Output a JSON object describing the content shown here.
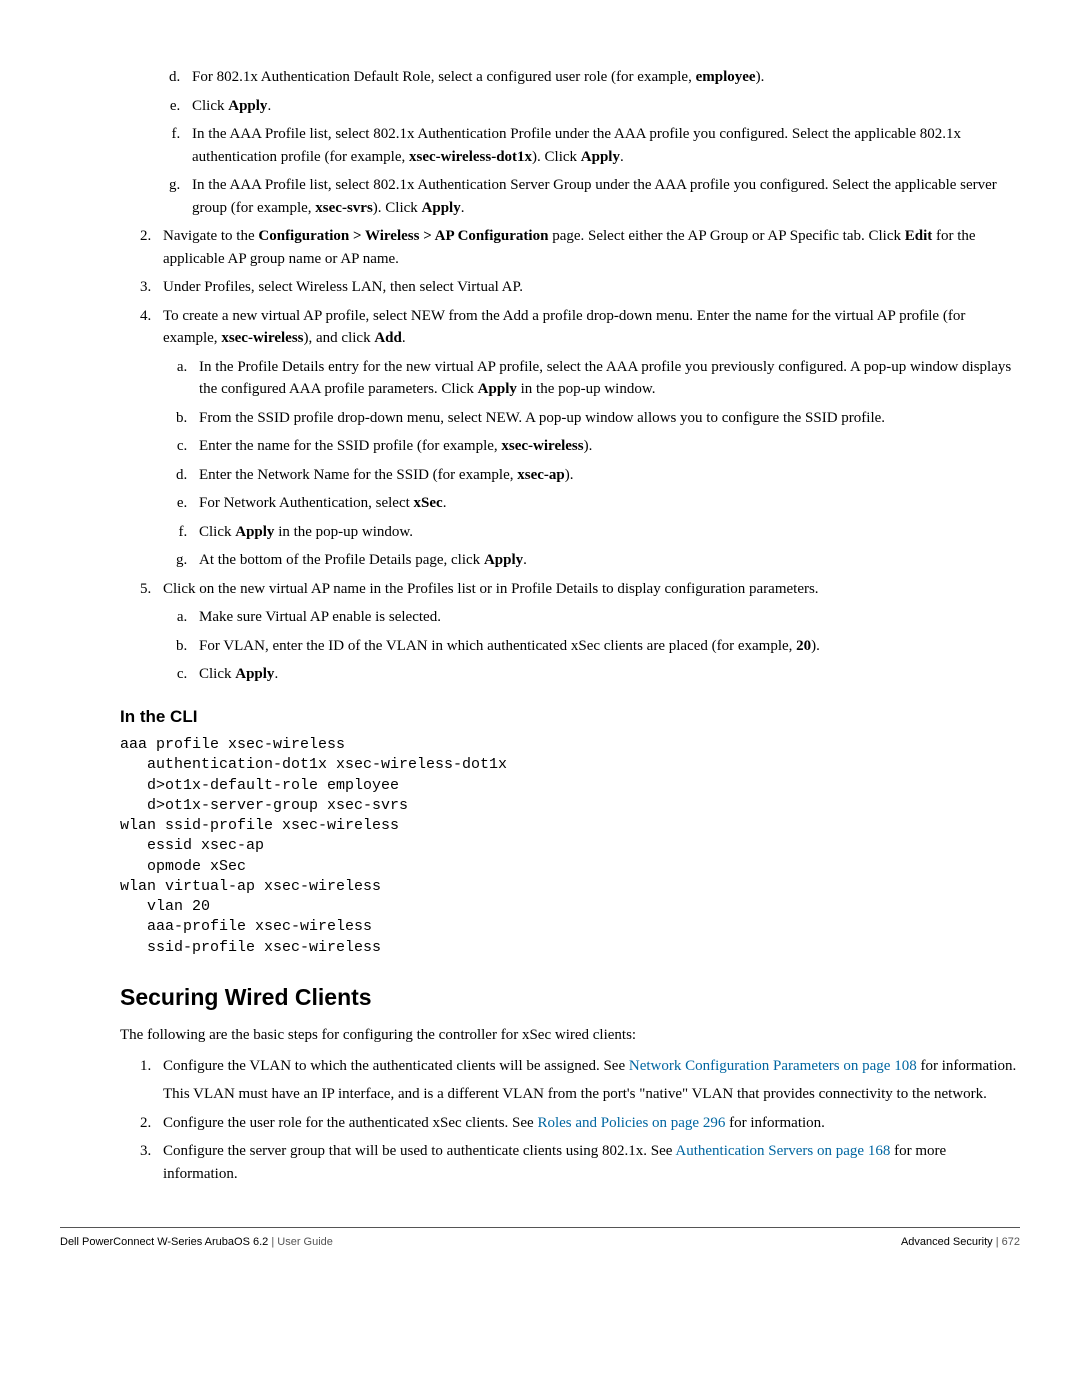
{
  "items_d": {
    "pre": "For 802.1x Authentication Default Role, select a configured user role (for example, ",
    "bold": "employee",
    "post": ")."
  },
  "items_e": {
    "pre": "Click ",
    "bold": "Apply",
    "post": "."
  },
  "items_f": {
    "pre": "In the AAA Profile list, select 802.1x Authentication Profile under the AAA profile you configured. Select the applicable 802.1x authentication profile (for example, ",
    "b1": "xsec-wireless-dot1x",
    "mid": "). Click ",
    "b2": "Apply",
    "post": "."
  },
  "items_g": {
    "pre": "In the AAA Profile list, select 802.1x Authentication Server Group under the AAA profile you configured. Select the applicable server group (for example, ",
    "b1": "xsec-svrs",
    "mid": "). Click ",
    "b2": "Apply",
    "post": "."
  },
  "step2": {
    "pre": "Navigate to the ",
    "b1": "Configuration > Wireless > AP Configuration",
    "mid": " page. Select either the AP Group or AP Specific tab. Click ",
    "b2": "Edit",
    "post": " for the applicable AP group name or AP name."
  },
  "step3": "Under Profiles, select Wireless LAN, then select Virtual AP.",
  "step4": {
    "pre": "To create a new virtual AP profile, select NEW from the Add a profile drop-down menu. Enter the name for the virtual AP profile (for example, ",
    "b1": "xsec-wireless",
    "mid": "), and click ",
    "b2": "Add",
    "post": "."
  },
  "step4a": {
    "pre": "In the Profile Details entry for the new virtual AP profile, select the AAA profile you previously configured. A pop-up window displays the configured AAA profile parameters. Click ",
    "b1": "Apply",
    "post": " in the pop-up window."
  },
  "step4b": "From the SSID profile drop-down menu, select NEW. A pop-up window allows you to configure the SSID profile.",
  "step4c": {
    "pre": "Enter the name for the SSID profile (for example, ",
    "b1": "xsec-wireless",
    "post": ")."
  },
  "step4d": {
    "pre": "Enter the Network Name for the SSID (for example, ",
    "b1": "xsec-ap",
    "post": ")."
  },
  "step4e": {
    "pre": "For Network Authentication, select ",
    "b1": "xSec",
    "post": "."
  },
  "step4f": {
    "pre": "Click ",
    "b1": "Apply",
    "post": " in the pop-up window."
  },
  "step4g": {
    "pre": "At the bottom of the Profile Details page, click ",
    "b1": "Apply",
    "post": "."
  },
  "step5": "Click on the new virtual AP name in the Profiles list or in Profile Details to display configuration parameters.",
  "step5a": "Make sure Virtual AP enable is selected.",
  "step5b": {
    "pre": "For VLAN, enter the ID of the VLAN in which authenticated xSec clients are placed (for example, ",
    "b1": "20",
    "post": ")."
  },
  "step5c": {
    "pre": "Click ",
    "b1": "Apply",
    "post": "."
  },
  "cli_heading": "In the CLI",
  "cli_code": "aaa profile xsec-wireless\n   authentication-dot1x xsec-wireless-dot1x\n   d>ot1x-default-role employee\n   d>ot1x-server-group xsec-svrs\nwlan ssid-profile xsec-wireless\n   essid xsec-ap\n   opmode xSec\nwlan virtual-ap xsec-wireless\n   vlan 20\n   aaa-profile xsec-wireless\n   ssid-profile xsec-wireless",
  "section_heading": "Securing Wired Clients",
  "para_intro": "The following are the basic steps for configuring the controller for xSec wired clients:",
  "wired1": {
    "pre": "Configure the VLAN to which the authenticated clients will be assigned. See ",
    "link": "Network Configuration Parameters on page 108",
    "post": " for information."
  },
  "wired1_note": "This VLAN must have an IP interface, and is a different VLAN from the port's \"native\" VLAN that provides connectivity to the network.",
  "wired2": {
    "pre": "Configure the user role for the authenticated xSec clients. See ",
    "link": "Roles and Policies on page 296",
    "post": " for information."
  },
  "wired3": {
    "pre": "Configure the server group that will be used to authenticate clients using 802.1x. See ",
    "link": "Authentication Servers on page 168",
    "post": " for more information."
  },
  "footer_left": "Dell PowerConnect W-Series ArubaOS 6.2 ",
  "footer_left2": "| User Guide",
  "footer_right_label": "Advanced Security  ",
  "footer_right_page": "|  672"
}
